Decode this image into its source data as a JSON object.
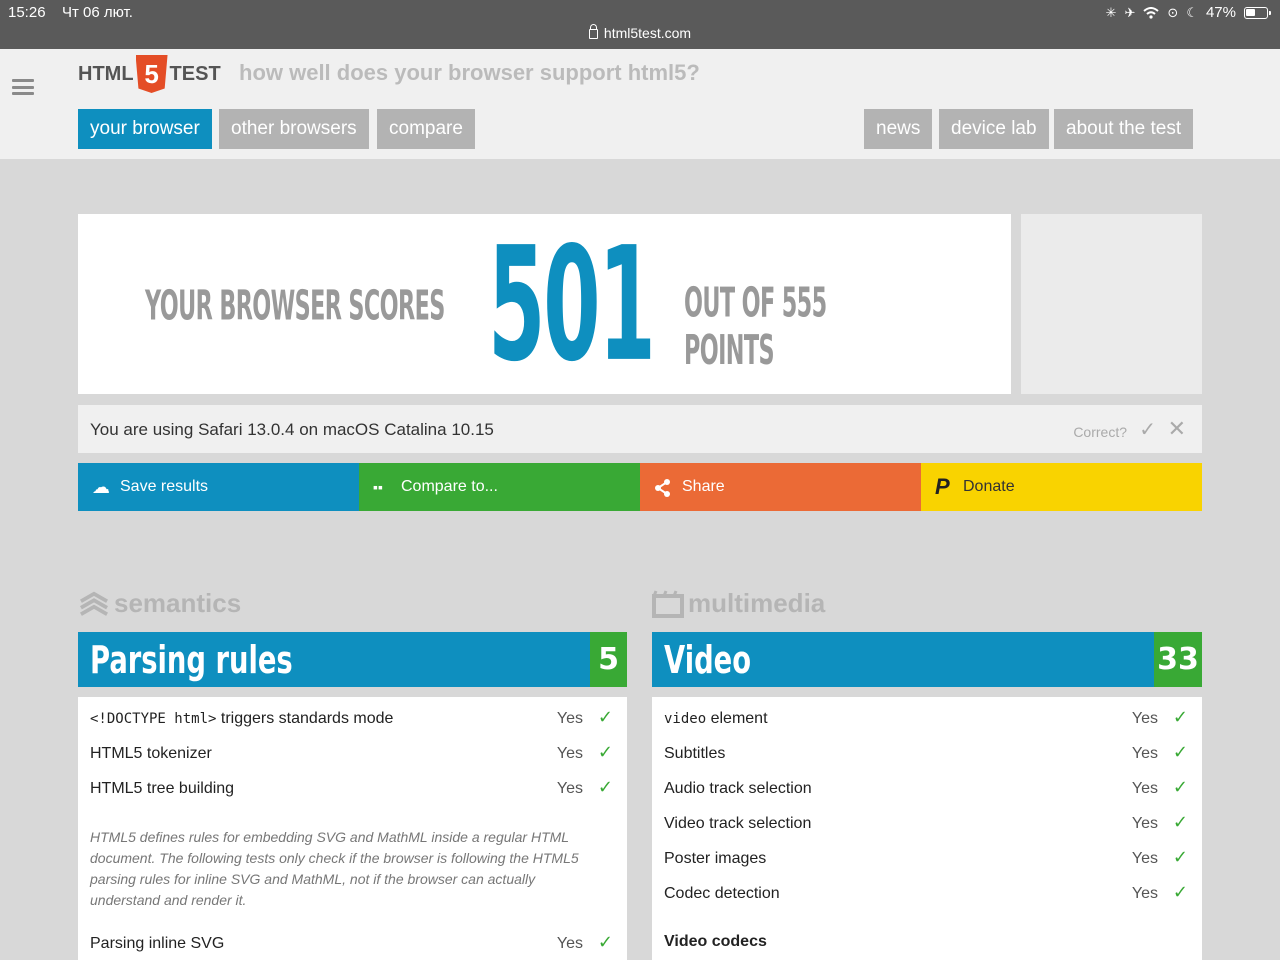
{
  "status_bar": {
    "time": "15:26",
    "date": "Чт 06 лют.",
    "url": "html5test.com",
    "battery": "47%",
    "icons": [
      "loading-spinner-icon",
      "airplane-icon",
      "wifi-icon",
      "orientation-lock-icon",
      "moon-icon",
      "battery-icon"
    ]
  },
  "header": {
    "logo_left": "HTML",
    "logo_badge": "5",
    "logo_right": "TEST",
    "tagline": "how well does your browser support html5?"
  },
  "nav": {
    "left": [
      "your browser",
      "other browsers",
      "compare"
    ],
    "right": [
      "news",
      "device lab",
      "about the test"
    ],
    "active": "your browser"
  },
  "score": {
    "prefix": "YOUR BROWSER SCORES",
    "value": "501",
    "suffix": "OUT OF 555 POINTS"
  },
  "detection": {
    "text": "You are using Safari 13.0.4 on macOS Catalina 10.15",
    "correct_label": "Correct?"
  },
  "actions": {
    "save": "Save results",
    "compare": "Compare to...",
    "share": "Share",
    "donate": "Donate"
  },
  "colors": {
    "blue": "#0e8fbf",
    "green": "#39a935",
    "orange": "#eb6a36",
    "yellow": "#f9d300",
    "html5_orange": "#e44d26"
  },
  "semantics": {
    "section": "semantics",
    "category": "Parsing rules",
    "points": "5",
    "rows": [
      {
        "label_code": "<!DOCTYPE html>",
        "label": " triggers standards mode",
        "result": "Yes"
      },
      {
        "label": "HTML5 tokenizer",
        "result": "Yes"
      },
      {
        "label": "HTML5 tree building",
        "result": "Yes"
      }
    ],
    "note": "HTML5 defines rules for embedding SVG and MathML inside a regular HTML document. The following tests only check if the browser is following the HTML5 parsing rules for inline SVG and MathML, not if the browser can actually understand and render it.",
    "rows2": [
      {
        "label": "Parsing inline SVG",
        "result": "Yes"
      }
    ]
  },
  "multimedia": {
    "section": "multimedia",
    "category": "Video",
    "points": "33",
    "rows": [
      {
        "label_code": "video",
        "label": " element",
        "result": "Yes"
      },
      {
        "label": "Subtitles",
        "result": "Yes"
      },
      {
        "label": "Audio track selection",
        "result": "Yes"
      },
      {
        "label": "Video track selection",
        "result": "Yes"
      },
      {
        "label": "Poster images",
        "result": "Yes"
      },
      {
        "label": "Codec detection",
        "result": "Yes"
      }
    ],
    "subhead": "Video codecs"
  }
}
